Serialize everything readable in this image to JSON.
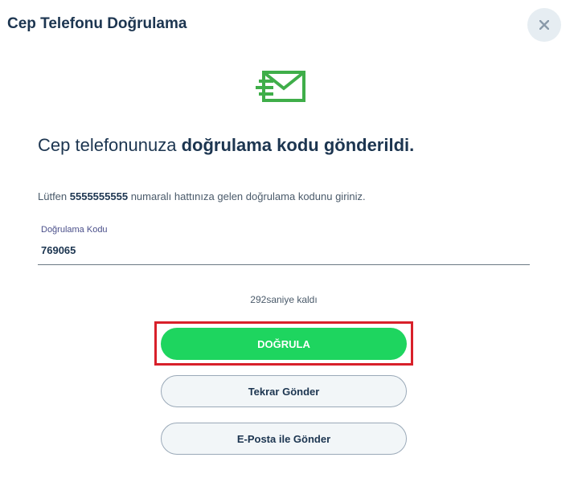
{
  "modal": {
    "title": "Cep Telefonu Doğrulama",
    "close_icon": "close-icon"
  },
  "icon": {
    "name": "mail-sent-icon",
    "color": "#3fae49"
  },
  "headline": {
    "prefix": "Cep telefonunuza ",
    "emphasis": "doğrulama kodu gönderildi."
  },
  "instruction": {
    "prefix": "Lütfen ",
    "phone": "5555555555",
    "suffix": " numaralı hattınıza gelen doğrulama kodunu giriniz."
  },
  "code_field": {
    "label": "Doğrulama Kodu",
    "value": "769065"
  },
  "countdown": {
    "text": "292saniye kaldı"
  },
  "buttons": {
    "verify": "DOĞRULA",
    "resend": "Tekrar Gönder",
    "email": "E-Posta ile Gönder"
  },
  "colors": {
    "primary": "#1ed55f",
    "highlight": "#d8202a",
    "text": "#1c3550"
  }
}
